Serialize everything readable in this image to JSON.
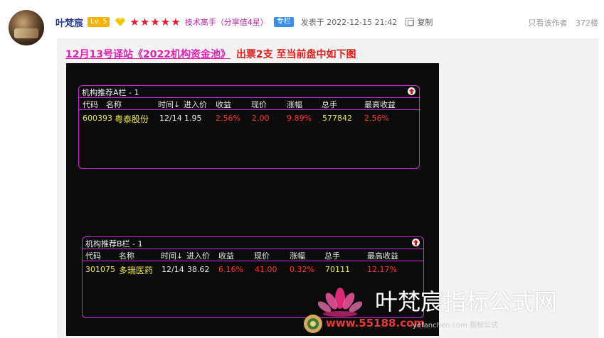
{
  "header": {
    "username": "叶梵宸",
    "level": "Lv. 5",
    "stars": "★★★★★",
    "title": "技术高手（分享值4星）",
    "badge": "专栏",
    "posted": "发表于 2022-12-15 21:42",
    "copy": "复制"
  },
  "meta": {
    "only_author": "只看该作者",
    "views": "372楼"
  },
  "post": {
    "headline_link": "12月13号译站《2022机构资金池》",
    "headline_tail": "出票2支  至当前盘中如下图"
  },
  "panel_a": {
    "title": "机构推荐A栏 - 1",
    "headers": [
      "代码",
      "名称",
      "时间↓",
      "进入价",
      "收益",
      "现价",
      "涨幅",
      "总手",
      "最高收益"
    ],
    "row": {
      "code": "600393",
      "name": "粤泰股份",
      "time": "12/14",
      "entry": "1.95",
      "gain": "2.56%",
      "price": "2.00",
      "change": "9.89%",
      "volume": "577842",
      "max_gain": "2.56%"
    }
  },
  "panel_b": {
    "title": "机构推荐B栏 - 1",
    "headers": [
      "代码",
      "名称",
      "时间↓",
      "进入价",
      "收益",
      "现价",
      "涨幅",
      "总手",
      "最高收益"
    ],
    "row": {
      "code": "301075",
      "name": "多瑞医药",
      "time": "12/14",
      "entry": "38.62",
      "gain": "6.16%",
      "price": "41.00",
      "change": "0.32%",
      "volume": "70111",
      "max_gain": "12.17%"
    }
  },
  "watermark": {
    "brand": "叶梵宸指标公式网",
    "url": "www.55188.com",
    "url2": "yefanchen.com 指标公式"
  },
  "colors": {
    "accent_magenta": "#d22ad8",
    "red": "#ff3333",
    "yellow": "#e8e84a"
  }
}
